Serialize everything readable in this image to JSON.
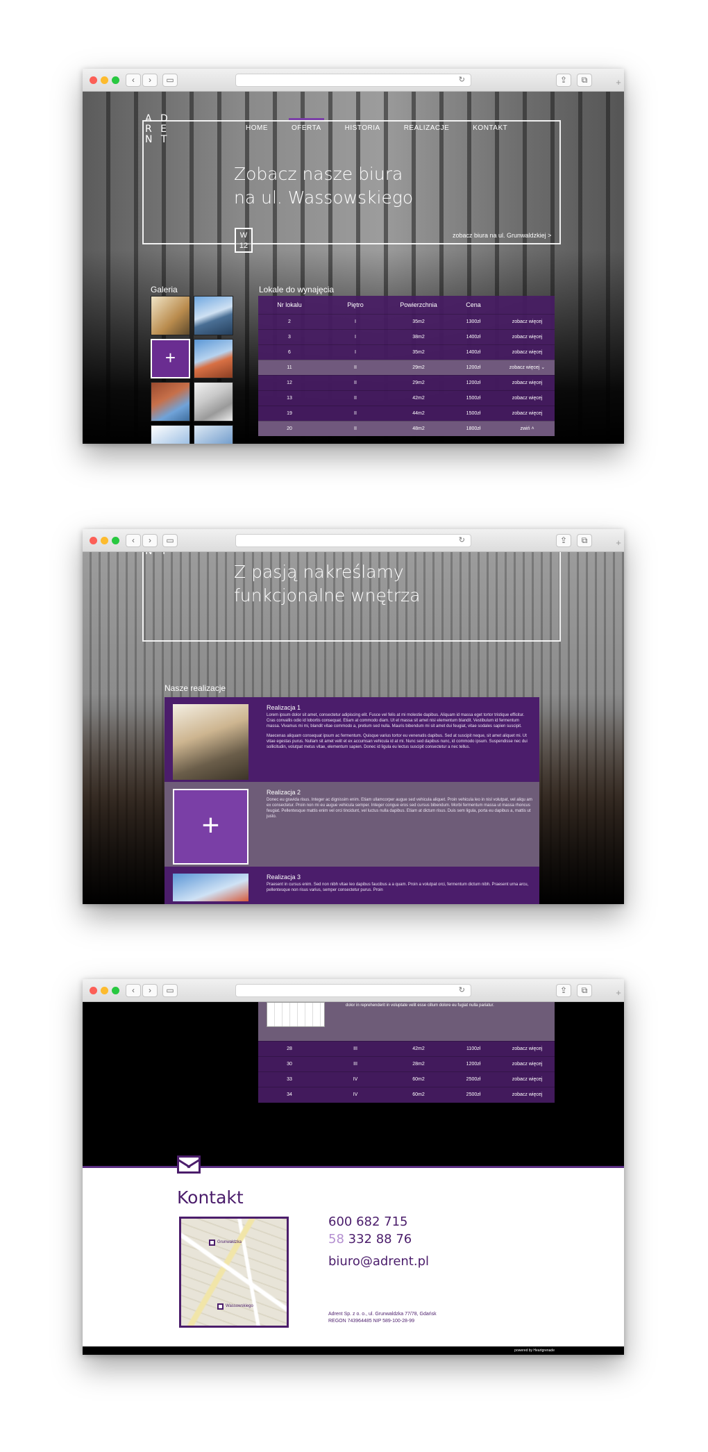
{
  "browser": {
    "back": "‹",
    "forward": "›",
    "reload": "↻",
    "new_tab": "+"
  },
  "nav": {
    "items": [
      "HOME",
      "OFERTA",
      "HISTORIA",
      "REALIZACJE",
      "KONTAKT"
    ],
    "active": "OFERTA"
  },
  "logo": {
    "lines": [
      "A D",
      "R E",
      "N T"
    ]
  },
  "page1": {
    "hero_line1": "Zobacz nasze biura",
    "hero_line2": "na ul. Wassowskiego",
    "badge_top": "W",
    "badge_bottom": "12",
    "alt_link": "zobacz biura na ul. Grunwaldzkiej >",
    "gallery_label": "Galeria",
    "gallery_plus": "+",
    "units_label": "Lokale do wynajęcia",
    "units_headers": [
      "Nr lokalu",
      "Piętro",
      "Powierzchnia",
      "Cena",
      ""
    ],
    "units_rows": [
      [
        "2",
        "I",
        "35m2",
        "1300zł",
        "zobacz więcej"
      ],
      [
        "3",
        "I",
        "38m2",
        "1400zł",
        "zobacz więcej"
      ],
      [
        "6",
        "I",
        "35m2",
        "1400zł",
        "zobacz więcej"
      ],
      [
        "11",
        "II",
        "29m2",
        "1200zł",
        "zobacz więcej"
      ],
      [
        "12",
        "II",
        "29m2",
        "1200zł",
        "zobacz więcej"
      ],
      [
        "13",
        "II",
        "42m2",
        "1500zł",
        "zobacz więcej"
      ],
      [
        "19",
        "II",
        "44m2",
        "1500zł",
        "zobacz więcej"
      ],
      [
        "20",
        "II",
        "48m2",
        "1800zł",
        "zwiń"
      ]
    ],
    "chevron_down": "⌄",
    "chevron_up": "˄",
    "accent_color": "#6a2d91"
  },
  "page2": {
    "hero_line1": "Z pasją nakreślamy",
    "hero_line2": "funkcjonalne wnętrza",
    "section_label": "Nasze realizacje",
    "items": [
      {
        "title": "Realizacja 1",
        "text1": "Lorem ipsum dolor sit amet, consectetur adipiscing elit. Fusce vel felis at mi molestie dapibus. Aliquam id massa eget tortor tristique efficitur. Cras convallis odio id lobortis consequat. Etiam at commodo diam. Ut et massa sit amet nisi elementum blandit. Vestibulum id fermentum massa. Vivamus mi mi, blandit vitae commodo a, pretium sed nulla. Mauris bibendum mi sit amet dui feugiat, vitae sodales sapien suscipit.",
        "text2": "Maecenas aliquam consequat ipsum ac fermentum. Quisque varius tortor eu venenatis dapibus. Sed at suscipit neque, sit amet aliquet mi. Ut vitae egestas purus. Nullam sit amet velit et ex accumsan vehicula id at mi. Nunc sed dapibus nunc, id commodo ipsum. Suspendisse nec dui sollicitudin, volutpat metus vitae, elementum sapien. Donec id ligula eu lectus suscipit consectetur a nec tellus."
      },
      {
        "title": "Realizacja 2",
        "text1": "Donec eu gravida risus. Integer ac dignissim enim. Etiam ullamcorper augue sed vehicula aliquet. Proin vehicula leo in nisl volutpat, vel aliqu am ex consectetur. Proin non mi eu augue vehicula semper. Integer congue eros sed cursus bibendum. Morbi fermentum massa ut massa rhoncus feugiat. Pellentesque mattis enim vel orci tincidunt, vel luctus nulla dapibus. Etiam at dictum risus. Duis sem ligula, porta eu dapibus a, mattis ut justo.",
        "text2": "",
        "plus": "+"
      },
      {
        "title": "Realizacja 3",
        "text1": "Praesent in cursus enim. Sed non nibh vitae leo dapibus faucibus a a quam. Proin a volutpat orci, fermentum dictum nibh. Praesent urna arcu, pellentesque non risus varius, semper consectetur purus. Proin",
        "text2": ""
      }
    ]
  },
  "page3": {
    "text_snippet": "dolor in reprehenderit in voluptate velit esse cillum dolore eu fugiat nulla pariatur.",
    "units_rows": [
      [
        "28",
        "III",
        "42m2",
        "1100zł",
        "zobacz więcej"
      ],
      [
        "30",
        "III",
        "28m2",
        "1200zł",
        "zobacz więcej"
      ],
      [
        "33",
        "IV",
        "60m2",
        "2500zł",
        "zobacz więcej"
      ],
      [
        "34",
        "IV",
        "60m2",
        "2500zł",
        "zobacz więcej"
      ]
    ],
    "contact_title": "Kontakt",
    "map_label_1": "Grunwaldzka",
    "map_label_2": "Wassowskiego",
    "phone1": "600 682 715",
    "phone2_prefix": "58",
    "phone2_rest": " 332 88 76",
    "email": "biuro@adrent.pl",
    "company_line1": "Adrent Sp. z o. o., ul. Grunwaldzka 77/78, Gdańsk",
    "company_line2": "REGON 743964485       NIP 589-100-28-99",
    "footer_note": "powered by Heartgrenade"
  }
}
